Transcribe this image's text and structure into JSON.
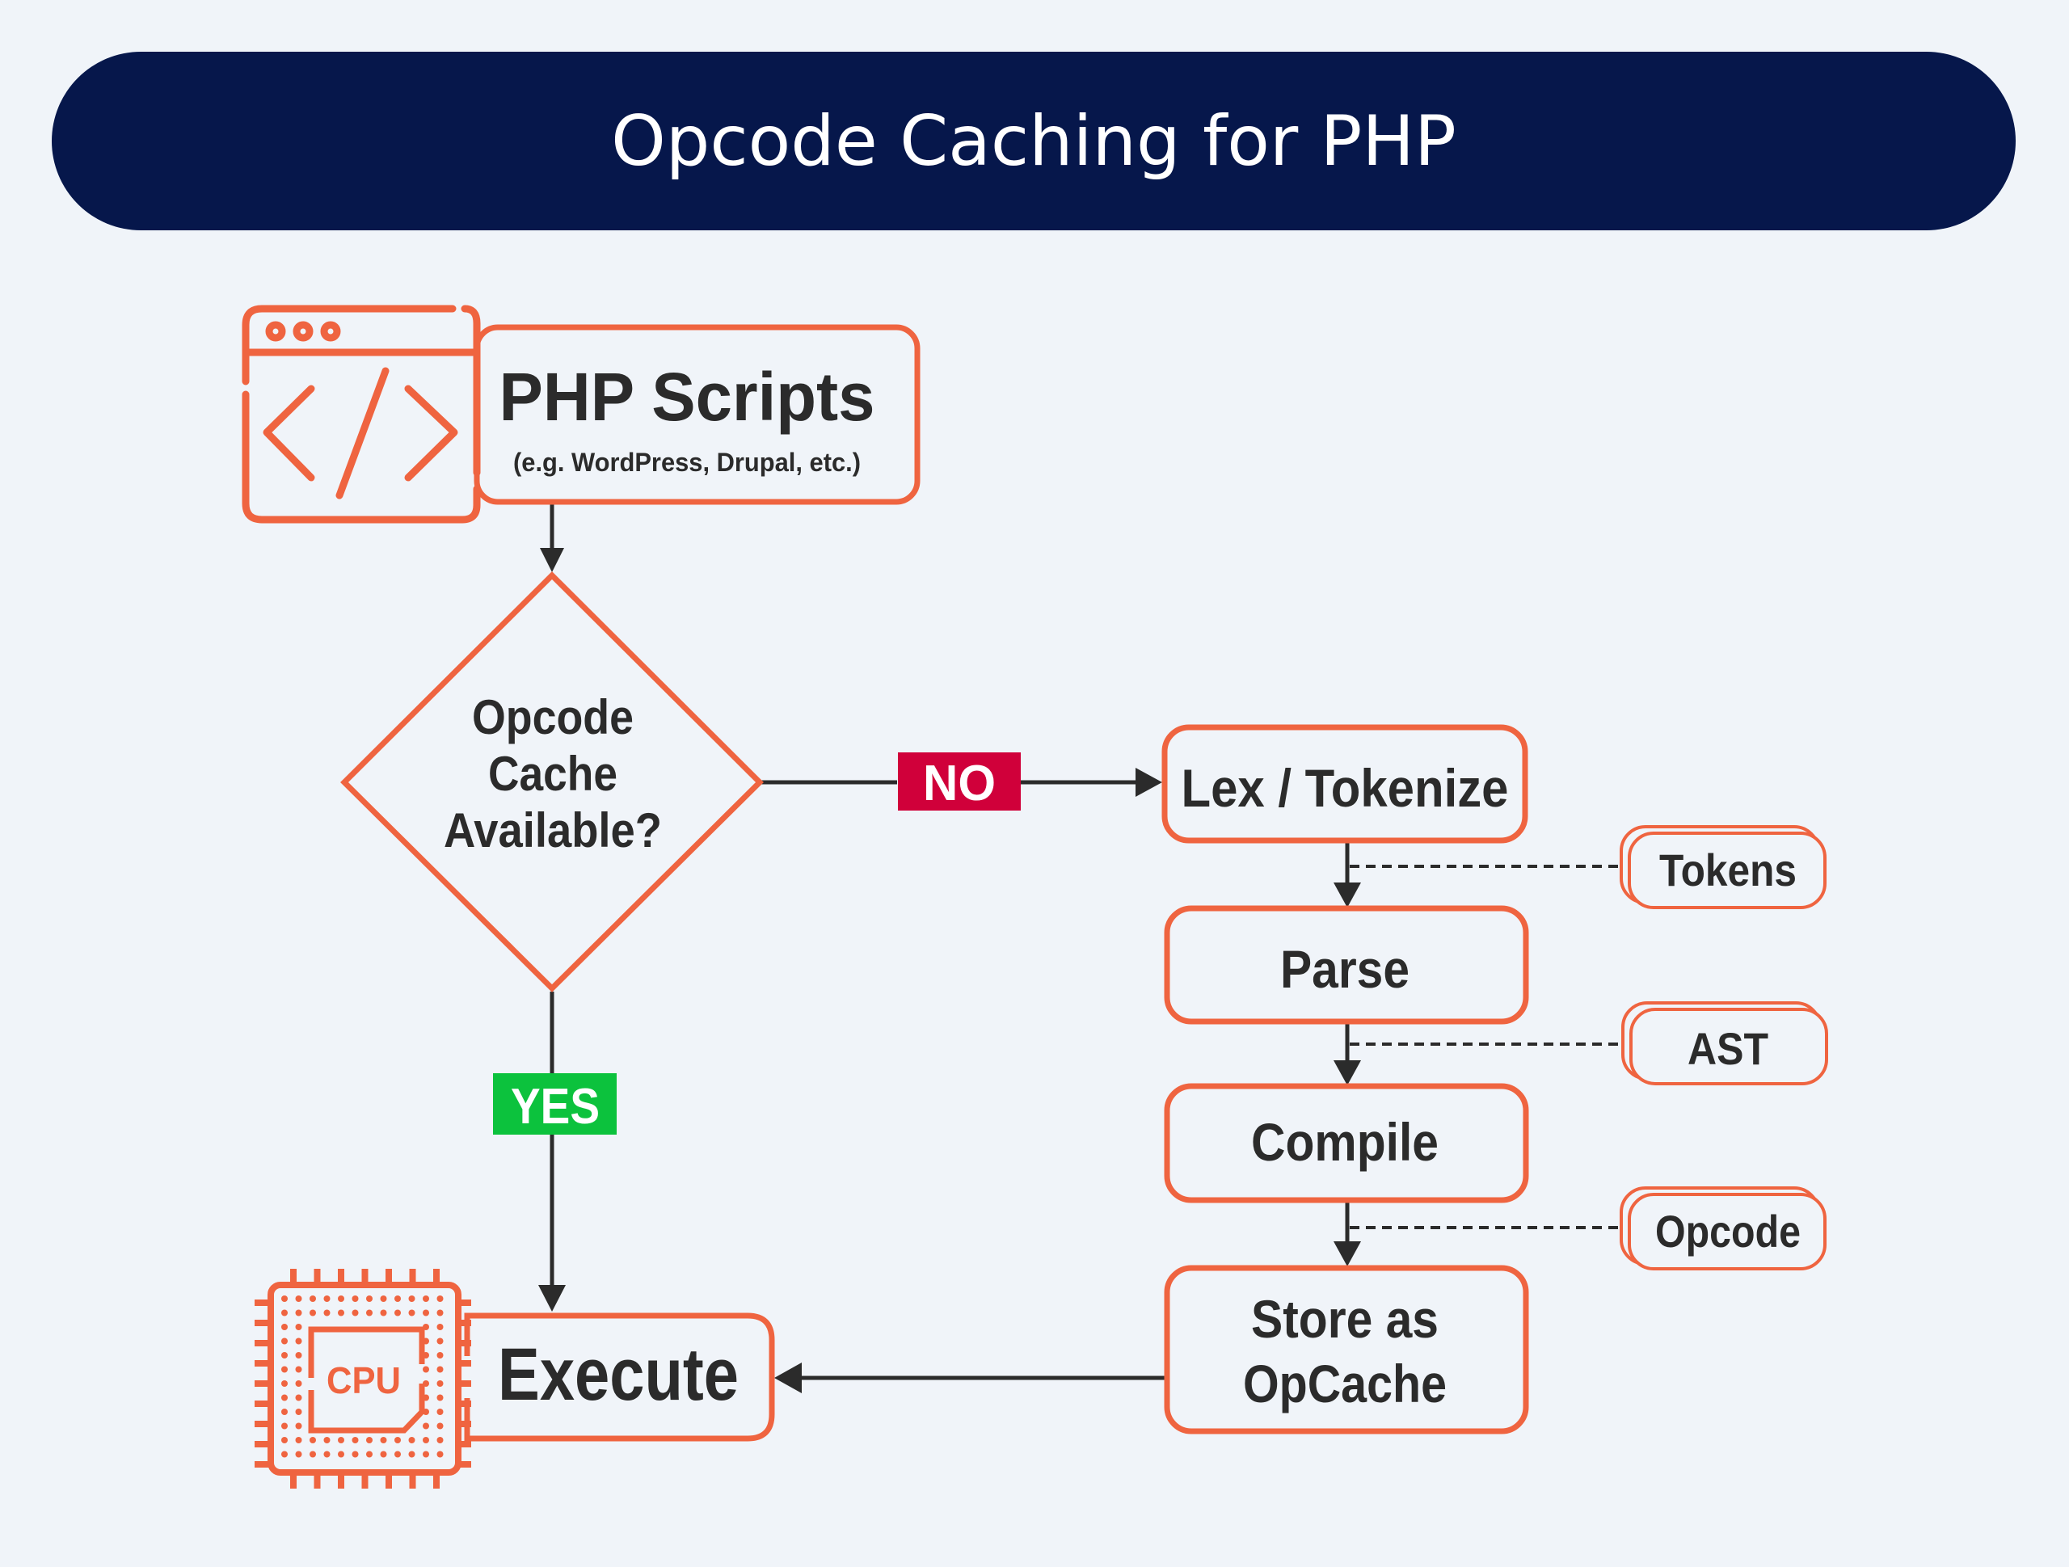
{
  "title": "Opcode Caching for PHP",
  "colors": {
    "background": "#f0f4f9",
    "title_bar": "#06174b",
    "accent": "#ef6440",
    "text": "#2b2b2b",
    "no_badge": "#d0003a",
    "yes_badge": "#0cc23d",
    "connector": "#2b2b2b"
  },
  "nodes": {
    "php_scripts": {
      "title": "PHP Scripts",
      "subtitle": "(e.g. WordPress, Drupal, etc.)",
      "icon": "code-window-icon"
    },
    "decision": {
      "lines": [
        "Opcode",
        "Cache",
        "Available?"
      ]
    },
    "lex": {
      "label": "Lex / Tokenize"
    },
    "parse": {
      "label": "Parse"
    },
    "compile": {
      "label": "Compile"
    },
    "store": {
      "lines": [
        "Store as",
        "OpCache"
      ]
    },
    "execute": {
      "label": "Execute",
      "icon": "cpu-icon",
      "icon_label": "CPU"
    }
  },
  "artifacts": [
    {
      "label": "Tokens"
    },
    {
      "label": "AST"
    },
    {
      "label": "Opcode"
    }
  ],
  "branches": {
    "no": "NO",
    "yes": "YES"
  }
}
